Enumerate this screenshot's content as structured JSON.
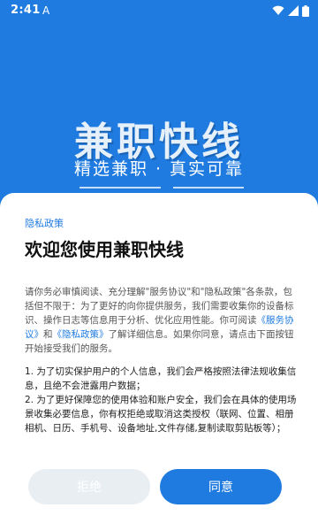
{
  "status_bar": {
    "time": "2:41",
    "notification_glyph": "A",
    "icons": [
      "wifi-icon",
      "signal-icon",
      "battery-icon"
    ]
  },
  "splash": {
    "title": "兼职快线",
    "subtitle": "精选兼职 · 真实可靠",
    "background_color": "#1f7be0"
  },
  "dialog": {
    "tag": "隐私政策",
    "heading": "欢迎您使用兼职快线",
    "intro_before": "请你务必审慎阅读、充分理解\"服务协议\"和\"隐私政策\"各条款，包括但不限于：为了更好的向你提供服务，我们需要收集你的设备标识、操作日志等信息用于分析、优化应用性能。你可阅读",
    "link_service": "《服务协议》",
    "intro_and": "和",
    "link_privacy": "《隐私政策》",
    "intro_after": "了解详细信息。如果你同意，请点击下面按钮开始接受我们的服务。",
    "term_1": "1. 为了切实保护用户的个人信息，我们会严格按照法律法规收集信息，且绝不会泄露用户数据；",
    "term_2": "2. 为了更好保障您的使用体验和账户安全，我们会在具体的使用场景收集必要信息，你有权拒绝或取消这类授权（联网、位置、相册相机、日历、手机号、设备地址,文件存储,复制读取剪贴板等）；",
    "reject_label": "拒绝",
    "agree_label": "同意",
    "accent_color": "#1f7be0"
  }
}
